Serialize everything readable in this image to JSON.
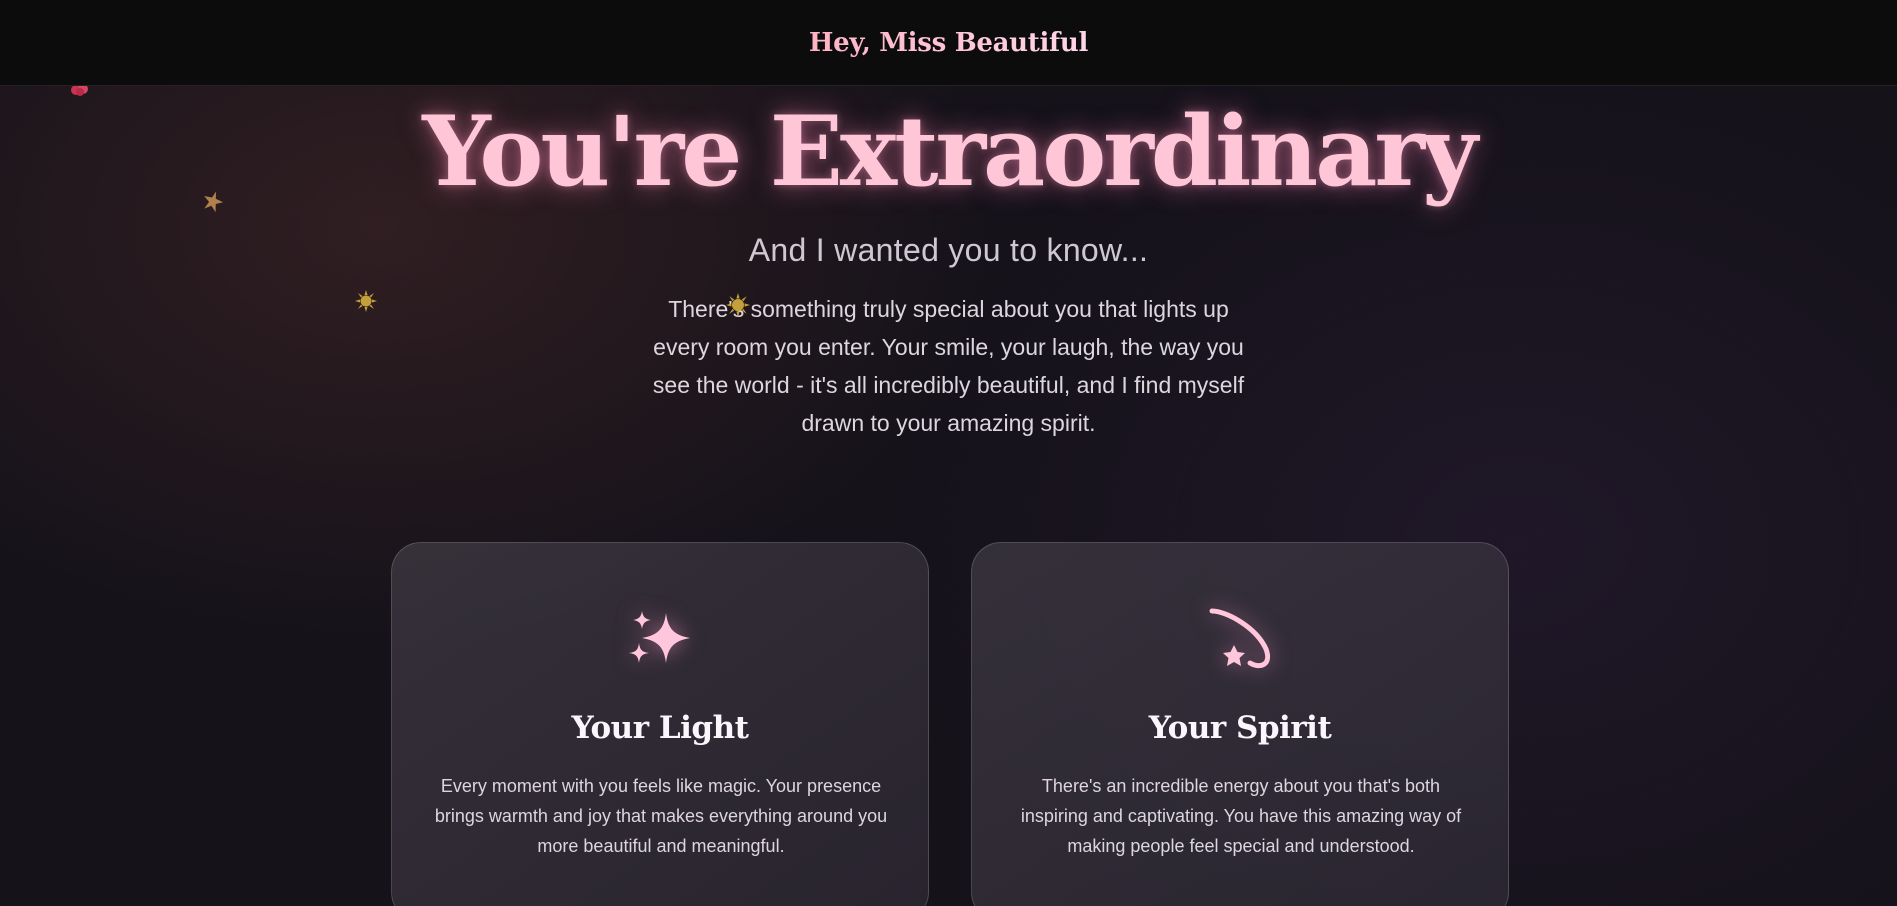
{
  "header": {
    "brand": "Hey, Miss Beautiful"
  },
  "hero": {
    "title": "You're Extraordinary",
    "subtitle": "And I wanted you to know...",
    "body": "There's something truly special about you that lights up every room you enter. Your smile, your laugh, the way you see the world - it's all incredibly beautiful, and I find myself drawn to your amazing spirit."
  },
  "cards": [
    {
      "icon": "sparkles-icon",
      "title": "Your Light",
      "text": "Every moment with you feels like magic. Your presence brings warmth and joy that makes everything around you more beautiful and meaningful."
    },
    {
      "icon": "shooting-star-icon",
      "title": "Your Spirit",
      "text": "There's an incredible energy about you that's both inspiring and captivating. You have this amazing way of making people feel special and understood."
    }
  ],
  "decorations": [
    {
      "icon": "rose-icon",
      "color": "#d23a5a"
    },
    {
      "icon": "star-icon",
      "color": "#b07a44"
    },
    {
      "icon": "sun-icon",
      "color": "#c4a03a"
    },
    {
      "icon": "sun-icon",
      "color": "#c4a03a"
    }
  ],
  "colors": {
    "accent": "#ffc6d8",
    "background": "#15121a",
    "header": "#0c0c0d"
  }
}
